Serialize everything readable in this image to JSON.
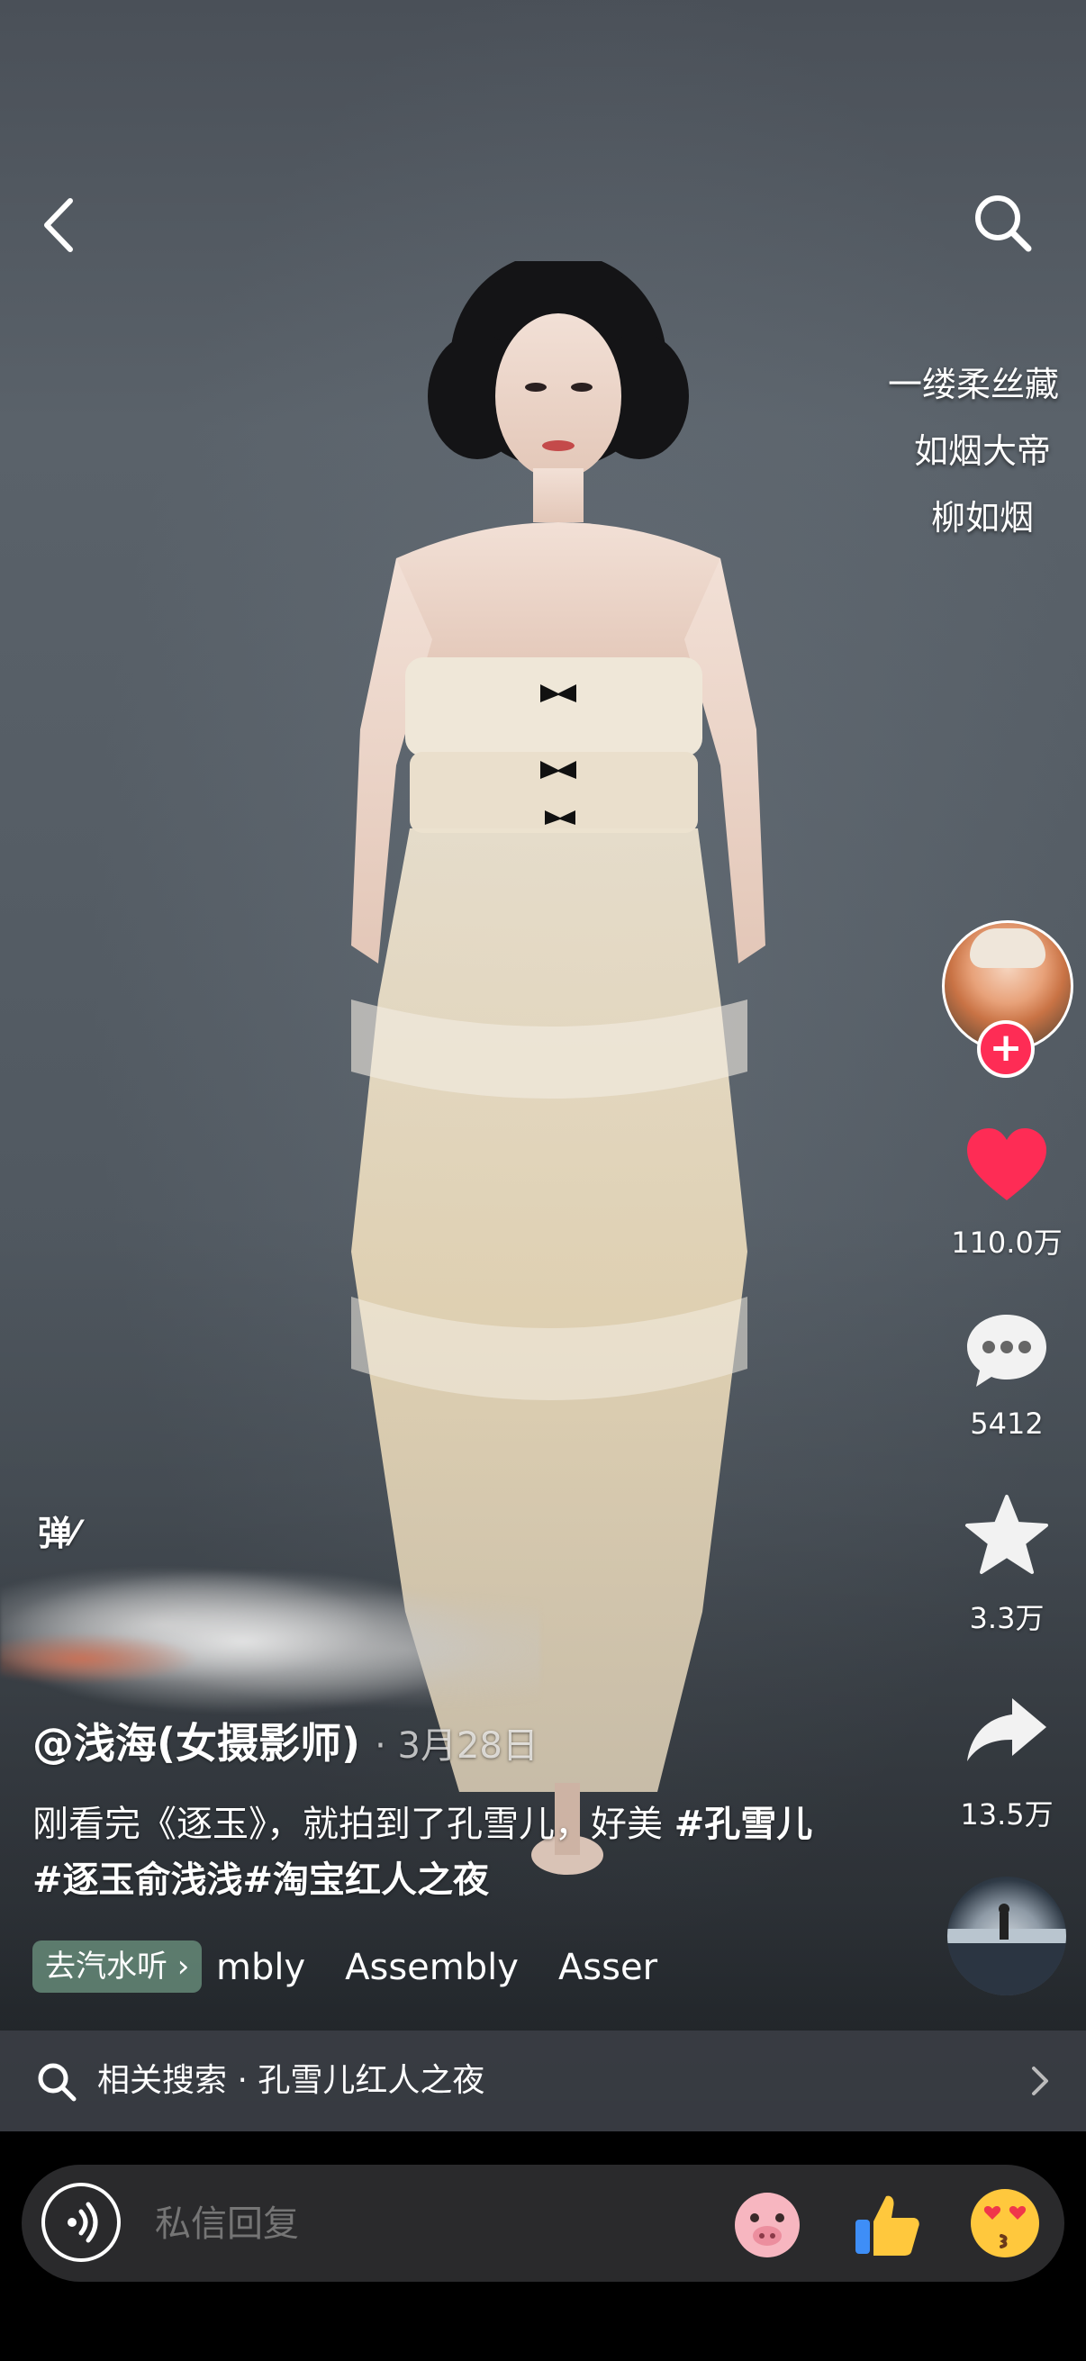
{
  "header": {
    "back_icon": "chevron-left-icon",
    "search_icon": "search-icon"
  },
  "lyrics": [
    "一缕柔丝藏",
    "如烟大帝",
    "柳如烟"
  ],
  "actions": {
    "like_count": "110.0万",
    "comment_count": "5412",
    "favorite_count": "3.3万",
    "share_count": "13.5万",
    "like_color": "#fe2c55",
    "follow_color": "#fe2c55"
  },
  "danmu": {
    "label": "弹"
  },
  "post": {
    "author": "@浅海(女摄影师)",
    "date": "· 3月28日",
    "caption_text": "刚看完《逐玉》，就拍到了孔雪儿，好美 ",
    "hashtags": [
      "#孔雪儿",
      "#逐玉俞浅浅",
      "#淘宝红人之夜"
    ]
  },
  "music": {
    "chip_label": "去汽水听",
    "marquee": [
      "mbly",
      "Assembly",
      "Asser"
    ]
  },
  "related_search": {
    "label": "相关搜索 · 孔雪儿红人之夜"
  },
  "reply_bar": {
    "placeholder": "私信回复",
    "emojis": [
      "pig-face-icon",
      "thumbs-up-icon",
      "heart-eyes-kiss-icon"
    ]
  }
}
